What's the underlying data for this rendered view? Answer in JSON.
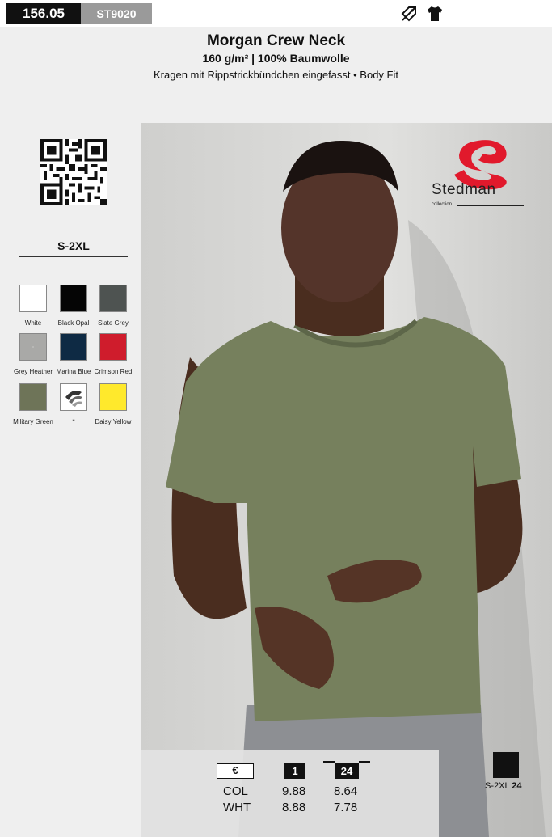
{
  "header": {
    "page_number": "156.05",
    "article_number": "ST9020",
    "icons": [
      "no-label-icon",
      "tshirt-icon"
    ]
  },
  "product": {
    "title": "Morgan Crew Neck",
    "subtitle": "160 g/m² | 100% Baumwolle",
    "description": "Kragen mit Rippstrickbündchen eingefasst • Body Fit"
  },
  "sizes": "S-2XL",
  "colors": [
    {
      "name": "White",
      "hex": "#ffffff"
    },
    {
      "name": "Black Opal",
      "hex": "#050505"
    },
    {
      "name": "Slate Grey",
      "hex": "#4e5351"
    },
    {
      "name": "Grey Heather",
      "hex": "#a9a9a7"
    },
    {
      "name": "Marina Blue",
      "hex": "#0e2a44"
    },
    {
      "name": "Crimson Red",
      "hex": "#cf1c2c"
    },
    {
      "name": "Military Green",
      "hex": "#6e7458"
    },
    {
      "name": "*",
      "hex": "#ffffff"
    },
    {
      "name": "Daisy Yellow",
      "hex": "#ffe92c"
    }
  ],
  "brand": {
    "name": "Stedman",
    "sub": "collection",
    "color": "#e1192c"
  },
  "pricing": {
    "currency": "€",
    "quantities": [
      "1",
      "24"
    ],
    "rows": [
      {
        "label": "COL",
        "prices": [
          "9.88",
          "8.64"
        ]
      },
      {
        "label": "WHT",
        "prices": [
          "8.88",
          "7.78"
        ]
      }
    ]
  },
  "box": {
    "sizes": "S-2XL",
    "count": "24"
  }
}
